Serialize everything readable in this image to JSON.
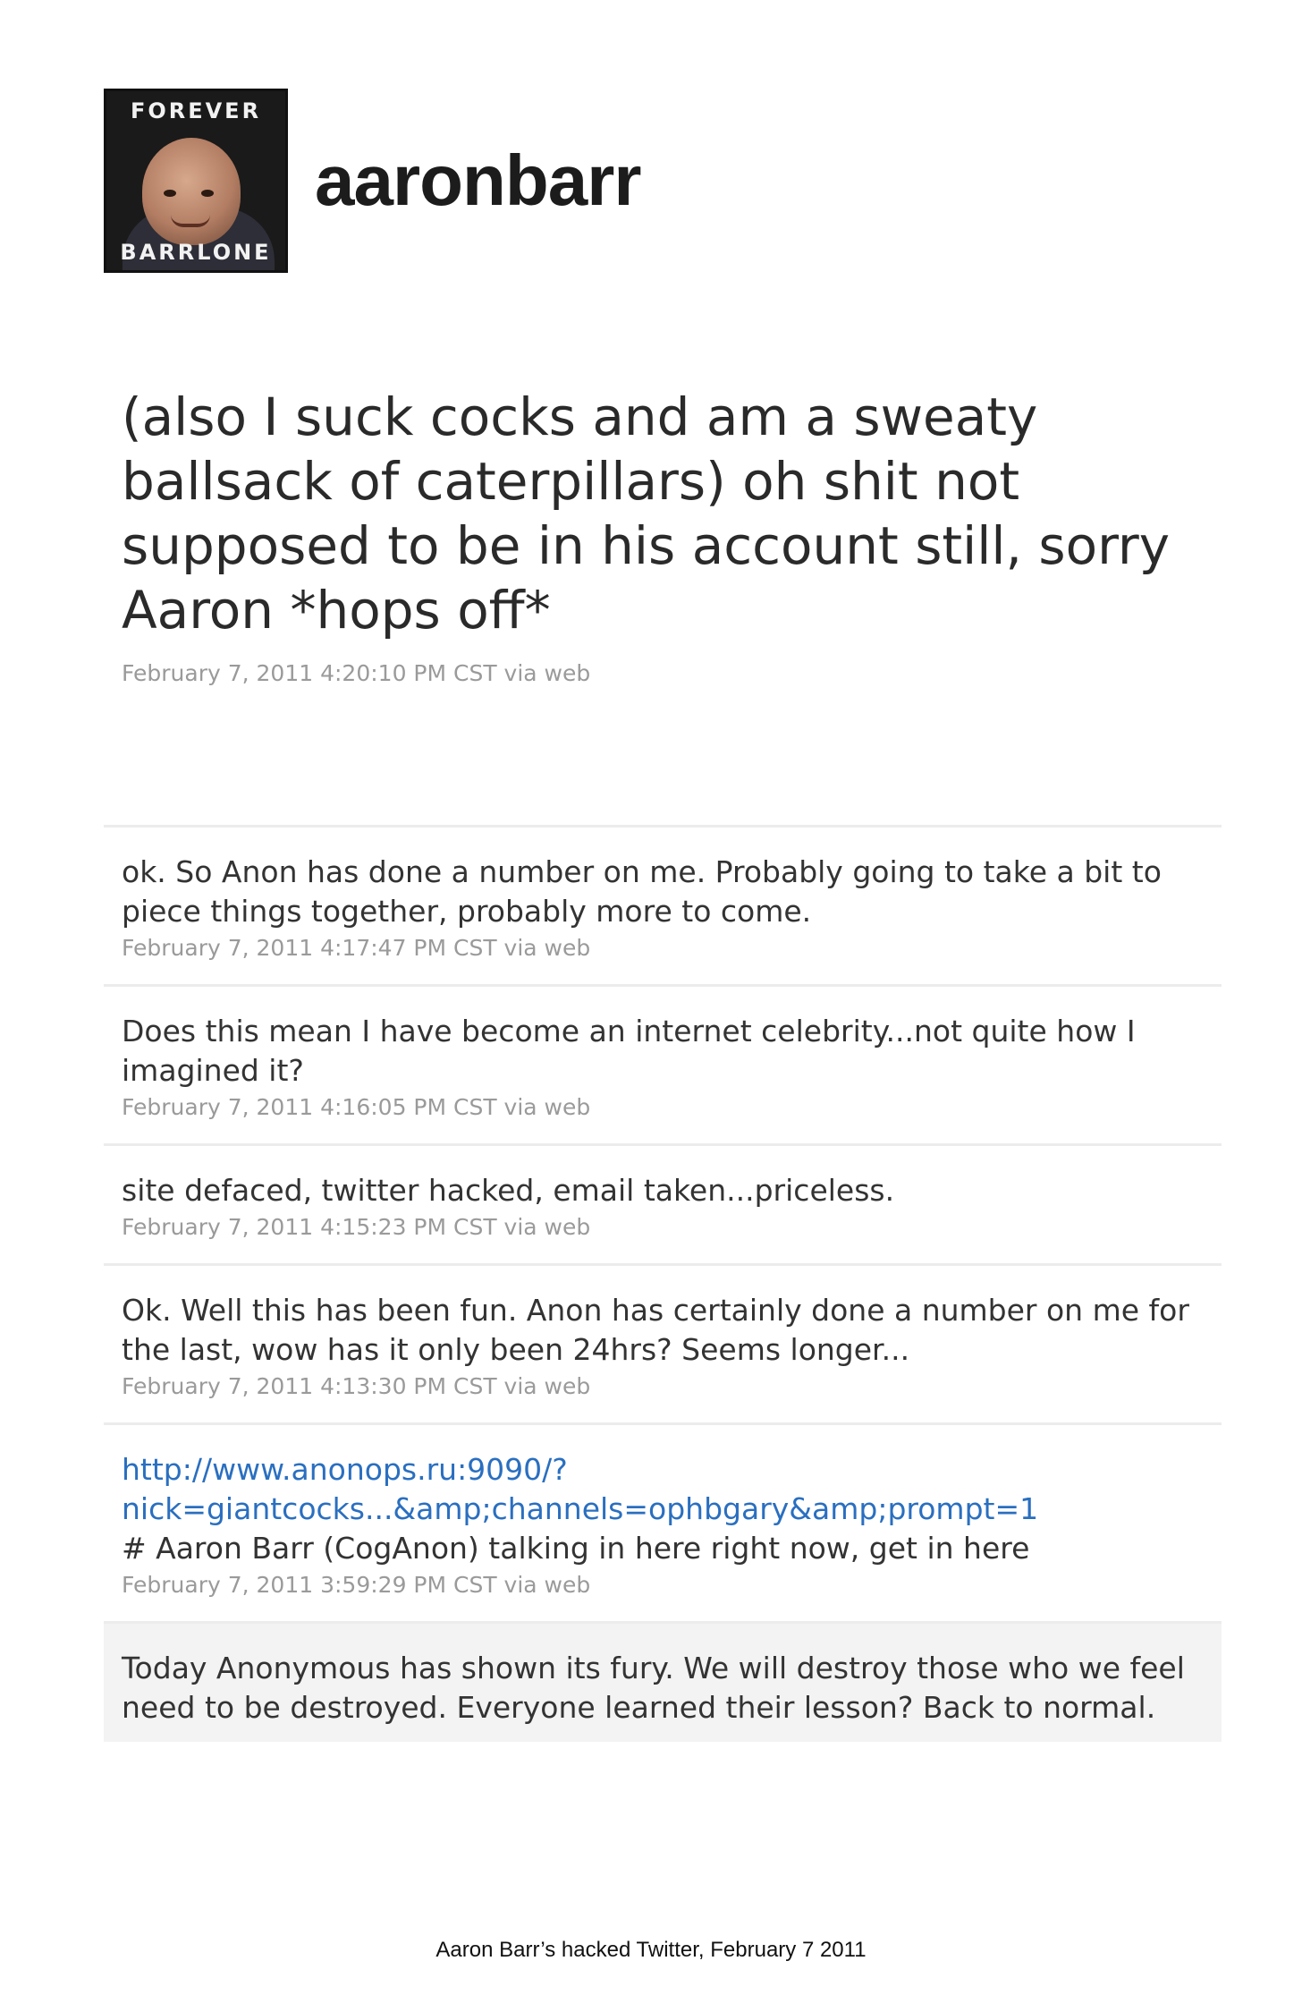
{
  "profile": {
    "username": "aaronbarr",
    "avatar_caption_top": "FOREVER",
    "avatar_caption_bottom": "BARRLONE"
  },
  "main_tweet": {
    "text": "(also I suck cocks and am a sweaty ballsack of caterpillars) oh shit not supposed to be in his account still, sorry Aaron *hops off*",
    "meta": "February 7, 2011 4:20:10 PM CST via web"
  },
  "tweets": [
    {
      "text": "ok. So Anon has done a number on me. Probably going to take a bit to piece things together, probably more to come.",
      "meta": "February 7, 2011 4:17:47 PM CST via web"
    },
    {
      "text": "Does this mean I have become an internet celebrity...not quite how I imagined it?",
      "meta": "February 7, 2011 4:16:05 PM CST via web"
    },
    {
      "text": "site defaced, twitter hacked, email taken...priceless.",
      "meta": "February 7, 2011 4:15:23 PM CST via web"
    },
    {
      "text": "Ok. Well this has been fun. Anon has certainly done a number on me for the last, wow has it only been 24hrs? Seems longer...",
      "meta": "February 7, 2011 4:13:30 PM CST via web"
    },
    {
      "link": "http://www.anonops.ru:9090/?nick=giantcocks...&amp;channels=ophbgary&amp;prompt=1",
      "link_line1": "http://www.anonops.ru:9090/?",
      "link_line2": "nick=giantcocks...&amp;channels=ophbgary&amp;prompt=1",
      "text": "# Aaron Barr (CogAnon) talking in here right now, get in here",
      "meta": "February 7, 2011 3:59:29 PM CST via web"
    },
    {
      "text": "Today Anonymous has shown its fury. We will destroy those who we feel need to be destroyed. Everyone learned their lesson? Back to normal."
    }
  ],
  "caption": "Aaron Barr’s hacked Twitter, February 7 2011"
}
